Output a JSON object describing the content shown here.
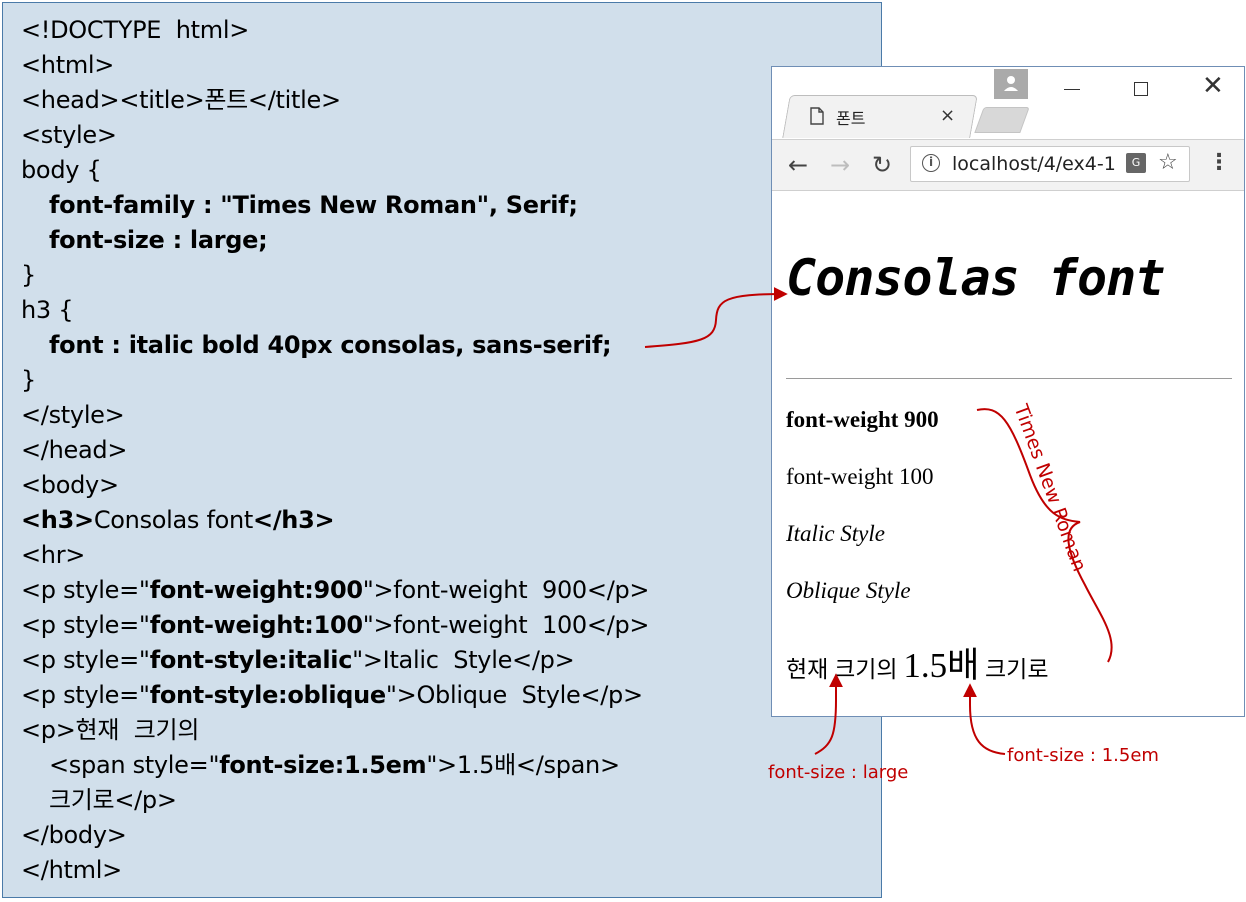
{
  "code": {
    "lines": [
      {
        "plain": "<!DOCTYPE  html>"
      },
      {
        "plain": "<html>"
      },
      {
        "plain": "<head><title>폰트</title>"
      },
      {
        "plain": "<style>"
      },
      {
        "plain": "body {"
      },
      {
        "bold": "font-family : \"Times New Roman\", Serif;"
      },
      {
        "bold": "font-size : large;"
      },
      {
        "plain": "}"
      },
      {
        "plain": "h3 {"
      },
      {
        "bold": "font : italic bold 40px consolas, sans-serif;"
      },
      {
        "plain": "}"
      },
      {
        "plain": "</style>"
      },
      {
        "plain": "</head>"
      },
      {
        "plain": "<body>"
      },
      {
        "bold_pre": "<h3>",
        "plain": "Consolas font",
        "bold_post": "</h3>"
      },
      {
        "plain": "<hr>"
      },
      {
        "pre": "<p style=\"",
        "bold": "font-weight:900",
        "post": "\">font-weight  900</p>"
      },
      {
        "pre": "<p style=\"",
        "bold": "font-weight:100",
        "post": "\">font-weight  100</p>"
      },
      {
        "pre": "<p style=\"",
        "bold": "font-style:italic",
        "post": "\">Italic  Style</p>"
      },
      {
        "pre": "<p style=\"",
        "bold": "font-style:oblique",
        "post": "\">Oblique  Style</p>"
      },
      {
        "plain": "<p>현재  크기의"
      },
      {
        "pre": "<span style=\"",
        "bold": "font-size:1.5em",
        "post": "\">1.5배</span>"
      },
      {
        "plain": "크기로</p>"
      },
      {
        "plain": "</body>"
      },
      {
        "plain": "</html>"
      }
    ]
  },
  "browser": {
    "tab_title": "폰트",
    "tab_close": "×",
    "url": "localhost/4/ex4-1",
    "translate_glyph": "G",
    "icons": {
      "tab": "page-icon",
      "profile": "profile-icon",
      "minimize": "minimize-icon",
      "maximize": "maximize-icon",
      "close": "close-icon",
      "back": "back-arrow-icon",
      "forward": "forward-arrow-icon",
      "reload": "reload-icon",
      "info": "info-icon",
      "translate": "translate-icon",
      "bookmark": "star-icon",
      "menu": "menu-dots-icon"
    }
  },
  "page": {
    "h3": "Consolas font",
    "p1": "font-weight 900",
    "p2": "font-weight 100",
    "p3": "Italic Style",
    "p4": "Oblique Style",
    "p5_pre": "현재 크기의 ",
    "p5_big": "1.5배",
    "p5_post": " 크기로"
  },
  "annotations": {
    "times_new_roman": "Times New Roman",
    "font_size_large": "font-size : large",
    "font_size_15em": "font-size : 1.5em",
    "color": "#c00000"
  }
}
